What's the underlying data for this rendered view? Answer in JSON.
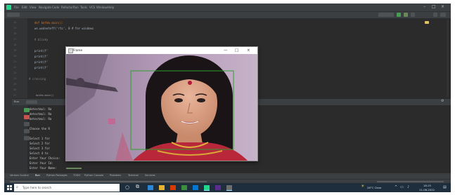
{
  "ide": {
    "menu": [
      "File",
      "Edit",
      "View",
      "Navigate",
      "Code",
      "Refactor",
      "Run",
      "Tools",
      "VCS",
      "Window",
      "Help"
    ],
    "code_lines": [
      {
        "num": "14",
        "text": "def bothm.main():",
        "color": "#cc7832",
        "indent": 1
      },
      {
        "num": "15",
        "text": "    ws.wsdsetoff('rtc', 0  # for  windows",
        "color": "#a9b7c6",
        "indent": 1
      },
      {
        "num": "16",
        "text": "",
        "color": "#a9b7c6",
        "indent": 0
      },
      {
        "num": "17",
        "text": "    # blinky",
        "color": "#808080",
        "indent": 1
      },
      {
        "num": "18",
        "text": "",
        "color": "#a9b7c6",
        "indent": 0
      },
      {
        "num": "19",
        "text": "    print(f'",
        "color": "#a9b7c6",
        "indent": 1
      },
      {
        "num": "20",
        "text": "    print(f'",
        "color": "#a9b7c6",
        "indent": 1
      },
      {
        "num": "21",
        "text": "    print(f'",
        "color": "#a9b7c6",
        "indent": 1
      },
      {
        "num": "22",
        "text": "    print(f'",
        "color": "#a9b7c6",
        "indent": 1
      },
      {
        "num": "23",
        "text": "",
        "color": "#a9b7c6",
        "indent": 0
      },
      {
        "num": "24",
        "text": "# crossing",
        "color": "#808080",
        "indent": 0
      }
    ],
    "extra_line_numbers": [
      "25",
      "26",
      "27"
    ],
    "breadcrumb": "bothm.main()",
    "console_lines": [
      "detectmul: Ra",
      "detectmul: Ra",
      "detectmul: Ra",
      "",
      "Choose the R",
      "",
      "Select 1 for",
      "Select 2 for",
      "Select 3 for",
      "Select 4 to",
      "Enter Your Choice:",
      "Enter Your Id:",
      "Enter Your Name:"
    ],
    "bottom_tabs": [
      "Version Control",
      "Run",
      "Python Packages",
      "TODO",
      "Python Console",
      "Problems",
      "Terminal",
      "Services"
    ],
    "colors": {
      "editor_bg": "#2b2b2b",
      "keyword": "#cc7832",
      "face_box": "#2e9e2e"
    }
  },
  "camera_window": {
    "title": "Frame",
    "controls": [
      "—",
      "□",
      "×"
    ]
  },
  "taskbar": {
    "search_placeholder": "Type here to search",
    "weather": "28°C Clear",
    "time": "18:15",
    "date": "11-06-2022"
  }
}
